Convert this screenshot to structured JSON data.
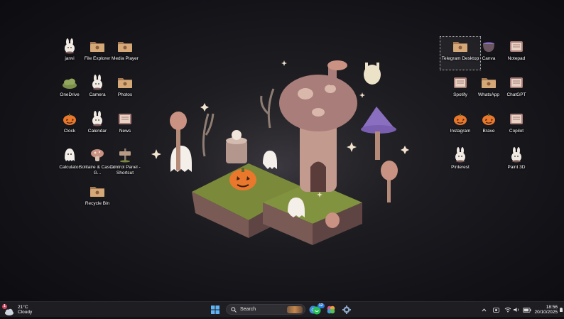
{
  "desktop": {
    "left_icons": [
      {
        "label": "janvi",
        "name": "janvi-icon",
        "kind": "bunny"
      },
      {
        "label": "File Explorer",
        "name": "file-explorer-icon",
        "kind": "folder"
      },
      {
        "label": "Media Player",
        "name": "media-player-icon",
        "kind": "folder"
      },
      {
        "label": "OneDrive",
        "name": "onedrive-icon",
        "kind": "cloud"
      },
      {
        "label": "Camera",
        "name": "camera-icon",
        "kind": "bunny"
      },
      {
        "label": "Photos",
        "name": "photos-icon",
        "kind": "folder"
      },
      {
        "label": "Clock",
        "name": "clock-icon",
        "kind": "pumpkin"
      },
      {
        "label": "Calendar",
        "name": "calendar-icon",
        "kind": "bunny"
      },
      {
        "label": "News",
        "name": "news-icon",
        "kind": "book"
      },
      {
        "label": "Calculator",
        "name": "calculator-icon",
        "kind": "ghost"
      },
      {
        "label": "Solitaire & Casual G...",
        "name": "solitaire-icon",
        "kind": "mushroom"
      },
      {
        "label": "Control Panel - Shortcut",
        "name": "control-panel-icon",
        "kind": "sign"
      },
      {
        "label": "Recycle Bin",
        "name": "recycle-bin-icon",
        "kind": "folder"
      }
    ],
    "right_icons": [
      {
        "label": "Telegram Desktop",
        "name": "telegram-icon",
        "kind": "folder",
        "selected": true
      },
      {
        "label": "Canva",
        "name": "canva-icon",
        "kind": "cauldron"
      },
      {
        "label": "Notepad",
        "name": "notepad-icon",
        "kind": "book"
      },
      {
        "label": "Spotify",
        "name": "spotify-icon",
        "kind": "book"
      },
      {
        "label": "WhatsApp",
        "name": "whatsapp-icon",
        "kind": "folder"
      },
      {
        "label": "ChatGPT",
        "name": "chatgpt-icon",
        "kind": "book"
      },
      {
        "label": "Instagram",
        "name": "instagram-icon",
        "kind": "pumpkin"
      },
      {
        "label": "Brave",
        "name": "brave-icon",
        "kind": "pumpkin"
      },
      {
        "label": "Copilot",
        "name": "copilot-icon",
        "kind": "book"
      },
      {
        "label": "Pinterest",
        "name": "pinterest-icon",
        "kind": "bunny"
      },
      {
        "label": "Paint 3D",
        "name": "paint-3d-icon",
        "kind": "bunny"
      }
    ]
  },
  "colors": {
    "accent": "#2f7bd8",
    "pumpkin": "#e9782c",
    "folder": "#c89a6a",
    "taskbar": "#1e1d22"
  },
  "taskbar": {
    "weather": {
      "temp": "21°C",
      "condition": "Cloudy",
      "badge": "1"
    },
    "search": {
      "placeholder": "Search"
    },
    "whatsapp_badge": "12",
    "clock": {
      "time": "18:56",
      "date": "20/10/2025"
    }
  }
}
